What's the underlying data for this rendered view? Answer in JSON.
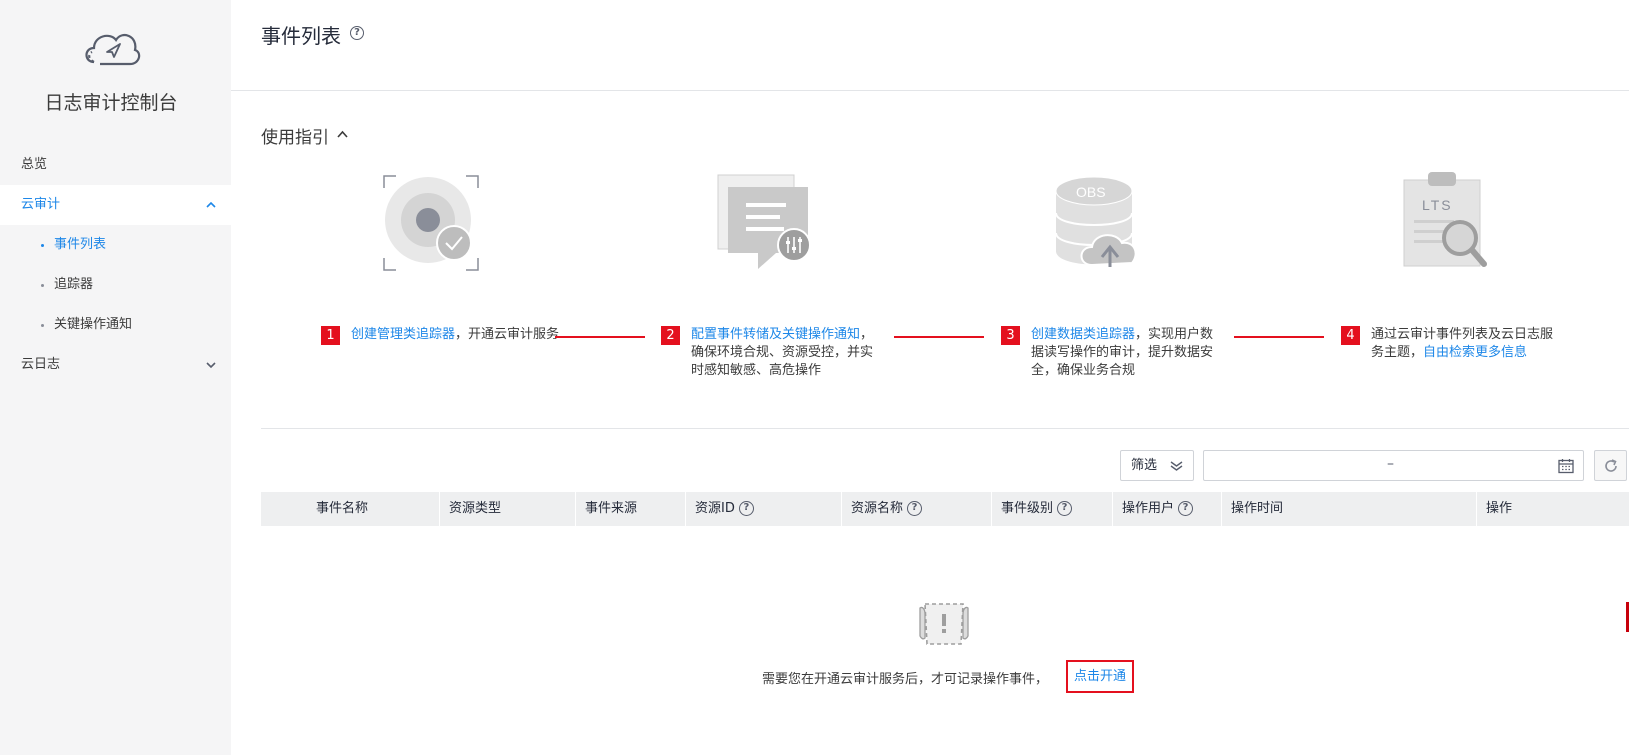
{
  "sidebar": {
    "title": "日志审计控制台",
    "items": [
      {
        "label": "总览"
      },
      {
        "label": "云审计"
      },
      {
        "label": "云日志"
      }
    ],
    "sub_items": [
      {
        "label": "事件列表"
      },
      {
        "label": "追踪器"
      },
      {
        "label": "关键操作通知"
      }
    ]
  },
  "header": {
    "title": "事件列表",
    "help": "?"
  },
  "guide": {
    "title": "使用指引",
    "steps": [
      {
        "num": "1",
        "link": "创建管理类追踪器",
        "text": "，开通云审计服务"
      },
      {
        "num": "2",
        "link": "配置事件转储及关键操作通知",
        "text": "，确保环境合规、资源受控，并实时感知敏感、高危操作"
      },
      {
        "num": "3",
        "link": "创建数据类追踪器",
        "text": "，实现用户数据读写操作的审计，提升数据安全，确保业务合规"
      },
      {
        "num": "4",
        "text": "通过云审计事件列表及云日志服务主题，",
        "link": "自由检索更多信息"
      }
    ],
    "icons": {
      "step3_label": "OBS",
      "step4_label": "LTS"
    }
  },
  "toolbar": {
    "filter_label": "筛选",
    "date_separator": "–"
  },
  "table": {
    "columns": [
      "事件名称",
      "资源类型",
      "事件来源",
      "资源ID",
      "资源名称",
      "事件级别",
      "操作用户",
      "操作时间",
      "操作"
    ],
    "empty_text": "需要您在开通云审计服务后，才可记录操作事件，",
    "empty_link": "点击开通"
  },
  "colors": {
    "accent": "#1d87e8",
    "step_red": "#e4101e"
  }
}
